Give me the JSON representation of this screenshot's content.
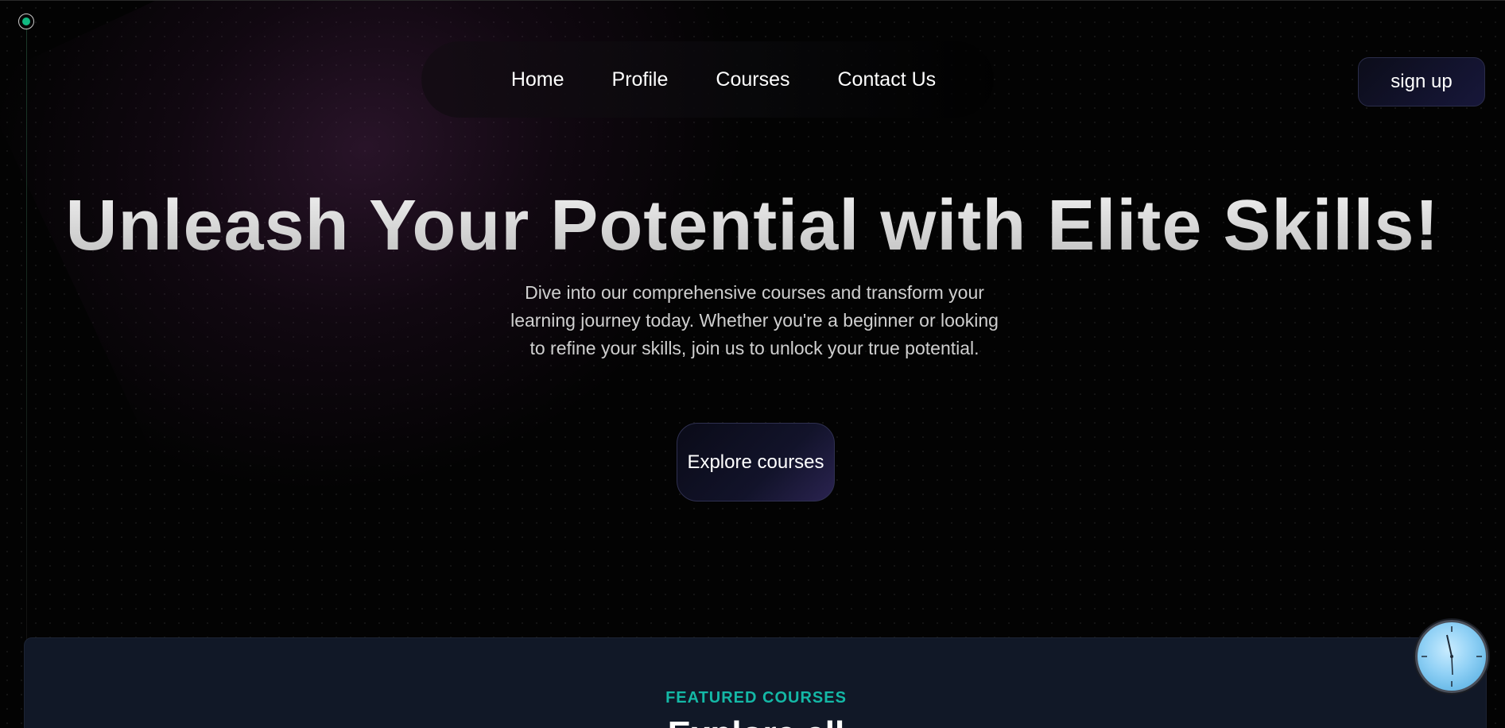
{
  "nav": {
    "items": [
      {
        "label": "Home"
      },
      {
        "label": "Profile"
      },
      {
        "label": "Courses"
      },
      {
        "label": "Contact Us"
      }
    ],
    "signup_label": "sign up"
  },
  "hero": {
    "title": "Unleash Your Potential with Elite Skills!",
    "subtitle": "Dive into our comprehensive courses and transform your learning journey today. Whether you're a beginner or looking to refine your skills, join us to unlock your true potential.",
    "cta_label": "Explore courses"
  },
  "featured": {
    "label": "FEATURED COURSES",
    "heading": "Explore all"
  },
  "colors": {
    "accent_teal": "#14b8a6",
    "status_green": "#10b981",
    "section_bg": "#111827"
  },
  "icons": {
    "status_dot": "status-dot-icon",
    "clock": "clock-icon"
  }
}
